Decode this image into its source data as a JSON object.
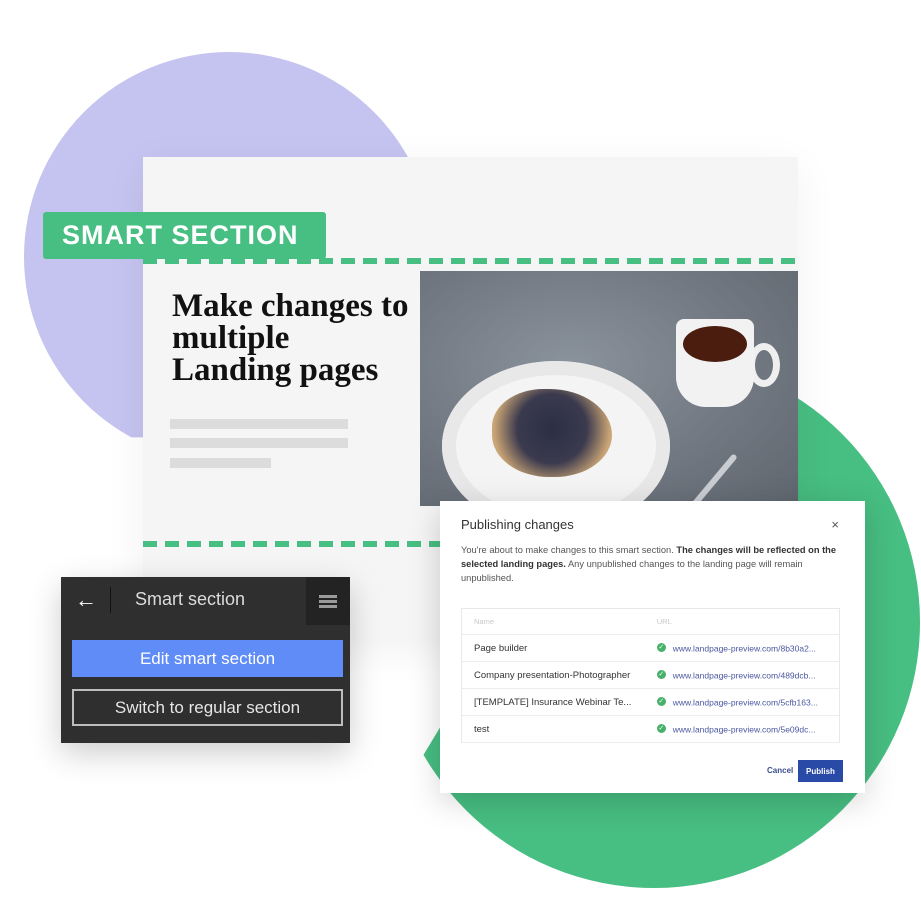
{
  "colors": {
    "accent_green": "#47be82",
    "accent_purple": "#c5c3ef",
    "edit_button_blue": "#5f8cf7",
    "publish_button_blue": "#2a4aa8"
  },
  "badge": {
    "label": "SMART SECTION"
  },
  "landing_page": {
    "headline": "Make changes to multiple Landing pages",
    "image": "dessert-and-tea-photo"
  },
  "editor_panel": {
    "back_icon": "arrow-left-icon",
    "title": "Smart section",
    "menu_icon": "list-icon",
    "edit_button": "Edit smart section",
    "switch_button": "Switch to regular section"
  },
  "dialog": {
    "title": "Publishing changes",
    "close_icon": "×",
    "body_intro": "You're about to make changes to this smart section. ",
    "body_bold": "The changes will be reflected on the selected landing pages.",
    "body_outro": " Any unpublished changes to the landing page will remain unpublished.",
    "table": {
      "headers": {
        "name": "Name",
        "url": "URL"
      },
      "rows": [
        {
          "name": "Page builder",
          "status": "published",
          "url": "www.landpage-preview.com/8b30a2..."
        },
        {
          "name": "Company presentation-Photographer",
          "status": "published",
          "url": "www.landpage-preview.com/489dcb..."
        },
        {
          "name": "[TEMPLATE] Insurance Webinar Te...",
          "status": "published",
          "url": "www.landpage-preview.com/5cfb163..."
        },
        {
          "name": "test",
          "status": "published",
          "url": "www.landpage-preview.com/5e09dc..."
        }
      ]
    },
    "cancel_button": "Cancel",
    "publish_button": "Publish"
  }
}
